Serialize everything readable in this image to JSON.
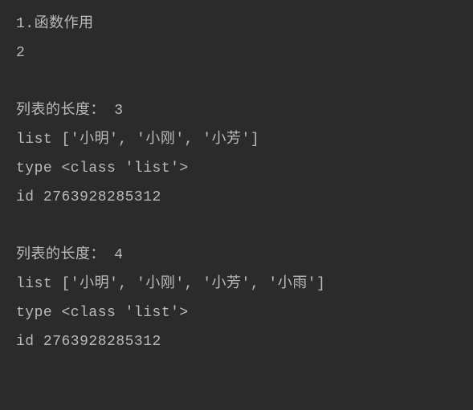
{
  "lines": {
    "line1": "1.函数作用",
    "line2": "2",
    "line3": "列表的长度： 3",
    "line4": "list ['小明', '小刚', '小芳']",
    "line5": "type <class 'list'>",
    "line6": "id 2763928285312",
    "line7": "列表的长度： 4",
    "line8": "list ['小明', '小刚', '小芳', '小雨']",
    "line9": "type <class 'list'>",
    "line10": "id 2763928285312"
  }
}
